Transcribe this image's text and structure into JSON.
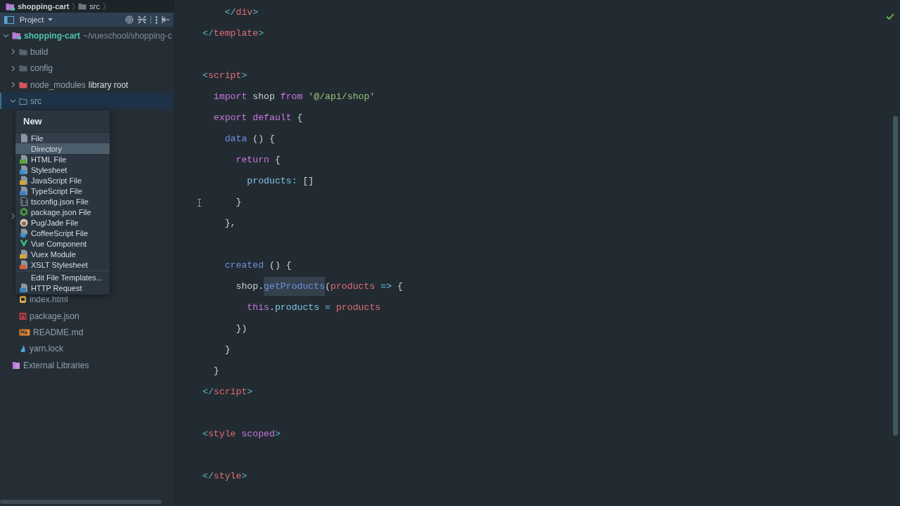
{
  "breadcrumb": [
    {
      "label": "shopping-cart",
      "kind": "project"
    },
    {
      "label": "src",
      "kind": "folder"
    }
  ],
  "project_panel": {
    "title": "Project"
  },
  "tree": [
    {
      "label": "shopping-cart",
      "path": "~/vueschool/shopping-c",
      "kind": "project",
      "expanded": true,
      "selected": false,
      "children": [
        {
          "label": "build",
          "kind": "folder",
          "expanded": false,
          "selected": false
        },
        {
          "label": "config",
          "kind": "folder",
          "expanded": false,
          "selected": false
        },
        {
          "label": "node_modules",
          "badge": "library root",
          "kind": "excluded_folder",
          "expanded": false,
          "selected": false
        },
        {
          "label": "src",
          "kind": "source_folder",
          "expanded": true,
          "selected": true
        },
        {
          "kind": "covered_folder",
          "expanded": false,
          "selected": false
        },
        {
          "label": "index.html",
          "kind": "html",
          "selected": false
        },
        {
          "label": "package.json",
          "kind": "npm",
          "selected": false
        },
        {
          "label": "README.md",
          "kind": "markdown",
          "selected": false
        },
        {
          "label": "yarn.lock",
          "kind": "yarn",
          "selected": false
        }
      ]
    },
    {
      "label": "External Libraries",
      "kind": "libraries",
      "selected": false
    }
  ],
  "new_menu": {
    "title": "New",
    "items": [
      {
        "label": "File",
        "kind": "file",
        "selected": false
      },
      {
        "label": "Directory",
        "kind": "plain",
        "selected": true
      },
      {
        "label": "HTML File",
        "kind": "html",
        "selected": false
      },
      {
        "label": "Stylesheet",
        "kind": "css",
        "selected": false
      },
      {
        "label": "JavaScript File",
        "kind": "js",
        "selected": false
      },
      {
        "label": "TypeScript File",
        "kind": "ts",
        "selected": false
      },
      {
        "label": "tsconfig.json File",
        "kind": "tsconfig",
        "selected": false
      },
      {
        "label": "package.json File",
        "kind": "node",
        "selected": false
      },
      {
        "label": "Pug/Jade File",
        "kind": "pug",
        "selected": false
      },
      {
        "label": "CoffeeScript File",
        "kind": "coffee",
        "selected": false
      },
      {
        "label": "Vue Component",
        "kind": "vue",
        "selected": false
      },
      {
        "label": "Vuex Module",
        "kind": "js",
        "selected": false
      },
      {
        "label": "XSLT Stylesheet",
        "kind": "xslt",
        "selected": false
      },
      {
        "kind": "separator"
      },
      {
        "label": "Edit File Templates...",
        "kind": "plain",
        "selected": false
      },
      {
        "label": "HTTP Request",
        "kind": "http",
        "selected": false
      }
    ]
  },
  "editor": {
    "lines": [
      {
        "kind": "code",
        "tokens": [
          {
            "kind": "bracket",
            "text": "    </"
          },
          {
            "kind": "tag",
            "text": "div"
          },
          {
            "kind": "bracket",
            "text": ">"
          }
        ]
      },
      {
        "kind": "code",
        "tokens": [
          {
            "kind": "bracket",
            "text": "</"
          },
          {
            "kind": "tag",
            "text": "template"
          },
          {
            "kind": "bracket",
            "text": ">"
          }
        ]
      },
      {
        "kind": "blank"
      },
      {
        "kind": "code",
        "tokens": [
          {
            "kind": "bracket",
            "text": "<"
          },
          {
            "kind": "tag",
            "text": "script"
          },
          {
            "kind": "bracket",
            "text": ">"
          }
        ]
      },
      {
        "kind": "code",
        "tokens": [
          {
            "kind": "keyword",
            "text": "  import"
          },
          {
            "kind": "plain",
            "text": " shop "
          },
          {
            "kind": "keyword",
            "text": "from"
          },
          {
            "kind": "string",
            "text": " '@/api/shop'"
          }
        ]
      },
      {
        "kind": "code",
        "tokens": [
          {
            "kind": "keyword",
            "text": "  export default"
          },
          {
            "kind": "plain",
            "text": " {"
          }
        ]
      },
      {
        "kind": "code",
        "tokens": [
          {
            "kind": "method",
            "text": "    data"
          },
          {
            "kind": "plain",
            "text": " () {"
          }
        ]
      },
      {
        "kind": "code",
        "tokens": [
          {
            "kind": "keyword",
            "text": "      return"
          },
          {
            "kind": "plain",
            "text": " {"
          }
        ]
      },
      {
        "kind": "code",
        "tokens": [
          {
            "kind": "property",
            "text": "        products"
          },
          {
            "kind": "operator",
            "text": ":"
          },
          {
            "kind": "plain",
            "text": " []"
          }
        ]
      },
      {
        "kind": "code",
        "tokens": [
          {
            "kind": "plain",
            "text": "      }"
          }
        ]
      },
      {
        "kind": "code",
        "tokens": [
          {
            "kind": "plain",
            "text": "    },"
          }
        ]
      },
      {
        "kind": "blank"
      },
      {
        "kind": "code",
        "tokens": [
          {
            "kind": "method",
            "text": "    created"
          },
          {
            "kind": "plain",
            "text": " () {"
          }
        ]
      },
      {
        "kind": "code",
        "tokens": [
          {
            "kind": "plain",
            "text": "      shop.",
            "highlighted": false
          },
          {
            "kind": "method",
            "text": "getProducts",
            "highlighted": true
          },
          {
            "kind": "plain",
            "text": "(",
            "highlighted": false
          },
          {
            "kind": "param",
            "text": "products",
            "highlighted": false
          },
          {
            "kind": "operator",
            "text": " =>",
            "highlighted": false
          },
          {
            "kind": "plain",
            "text": " {",
            "highlighted": false
          }
        ]
      },
      {
        "kind": "code",
        "tokens": [
          {
            "kind": "keyword",
            "text": "        this"
          },
          {
            "kind": "plain",
            "text": "."
          },
          {
            "kind": "property",
            "text": "products"
          },
          {
            "kind": "operator",
            "text": " ="
          },
          {
            "kind": "param",
            "text": " products"
          }
        ]
      },
      {
        "kind": "code",
        "tokens": [
          {
            "kind": "plain",
            "text": "      })"
          }
        ]
      },
      {
        "kind": "code",
        "tokens": [
          {
            "kind": "plain",
            "text": "    }"
          }
        ]
      },
      {
        "kind": "code",
        "tokens": [
          {
            "kind": "plain",
            "text": "  }"
          }
        ]
      },
      {
        "kind": "code",
        "tokens": [
          {
            "kind": "bracket",
            "text": "</"
          },
          {
            "kind": "tag",
            "text": "script"
          },
          {
            "kind": "bracket",
            "text": ">"
          }
        ]
      },
      {
        "kind": "blank"
      },
      {
        "kind": "code",
        "tokens": [
          {
            "kind": "bracket",
            "text": "<"
          },
          {
            "kind": "tag",
            "text": "style"
          },
          {
            "kind": "attr",
            "text": " scoped"
          },
          {
            "kind": "bracket",
            "text": ">"
          }
        ]
      },
      {
        "kind": "blank"
      },
      {
        "kind": "code",
        "tokens": [
          {
            "kind": "bracket",
            "text": "</"
          },
          {
            "kind": "tag",
            "text": "style"
          },
          {
            "kind": "bracket",
            "text": ">"
          }
        ]
      }
    ]
  }
}
